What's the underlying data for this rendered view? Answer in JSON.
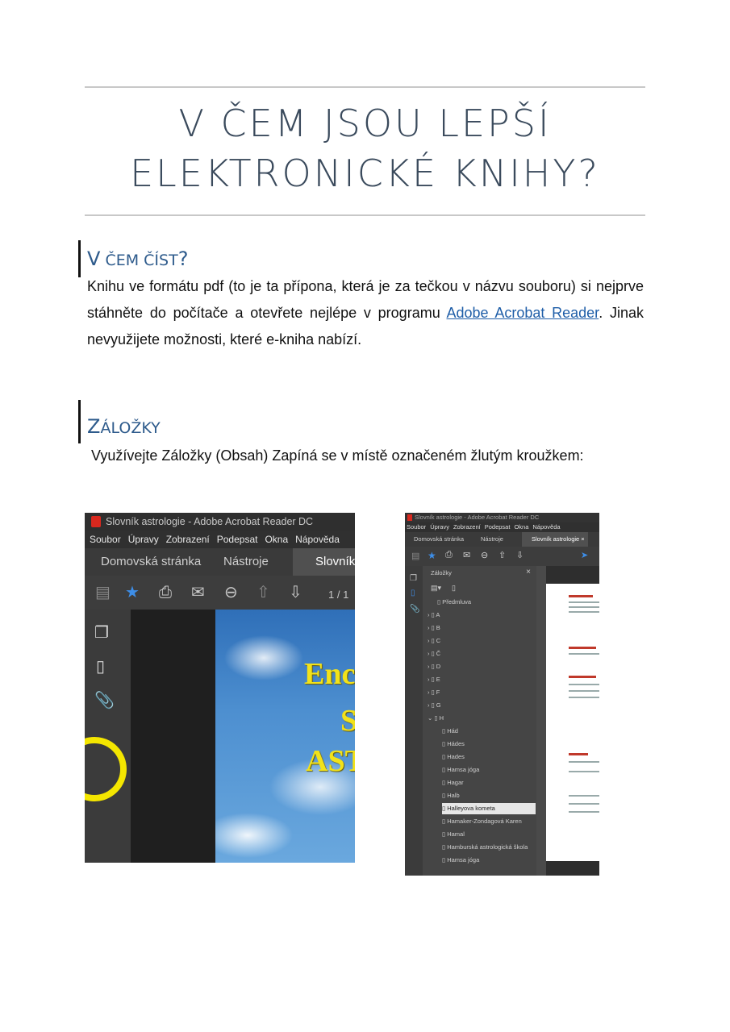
{
  "document": {
    "title_line1": "V ČEM JSOU LEPŠÍ",
    "title_line2": "ELEKTRONICKÉ KNIHY?",
    "section1": {
      "heading_first": "V",
      "heading_rest": " ČEM ČÍST",
      "heading_mark": "?",
      "para_before_link": "Knihu ve formátu pdf (to je ta přípona, která je za tečkou v názvu souboru) si nejprve stáhněte do počítače a otevřete nejlépe v programu ",
      "link_text": "Adobe Acrobat Reader",
      "para_after_link": ". Jinak nevyužijete možnosti, které e-kniha nabízí."
    },
    "section2": {
      "heading_first": "Z",
      "heading_rest": "ÁLOŽKY",
      "para": "Využívejte Záložky (Obsah) Zapíná se v místě označeném žlutým kroužkem:"
    }
  },
  "screenshot1": {
    "window_title": "Slovník astrologie - Adobe Acrobat Reader DC",
    "menu": [
      "Soubor",
      "Úpravy",
      "Zobrazení",
      "Podepsat",
      "Okna",
      "Nápověda"
    ],
    "tabs": [
      "Domovská stránka",
      "Nástroje",
      "Slovník a"
    ],
    "page_indicator": "1 / 1",
    "cover_lines": [
      "Enc",
      "S",
      "AST"
    ],
    "highlight_color": "#f4e600"
  },
  "screenshot2": {
    "window_title": "Slovník astrologie - Adobe Acrobat Reader DC",
    "menu": [
      "Soubor",
      "Úpravy",
      "Zobrazení",
      "Podepsat",
      "Okna",
      "Nápověda"
    ],
    "tabs": [
      "Domovská stránka",
      "Nástroje",
      "Slovník astrologie"
    ],
    "panel_title": "Záložky",
    "bookmarks": [
      "Předmluva",
      "A",
      "B",
      "C",
      "Č",
      "D",
      "E",
      "F",
      "G",
      "H",
      "Hád",
      "Hádes",
      "Hades",
      "Hamsa jóga",
      "Hagar",
      "Halb",
      "Halleyova kometa",
      "Hamaker-Zondagová Karen",
      "Hamal",
      "Hamburská astrologická škola",
      "Hamsa jóga"
    ],
    "selected_bookmark": "Halleyova kometa"
  }
}
